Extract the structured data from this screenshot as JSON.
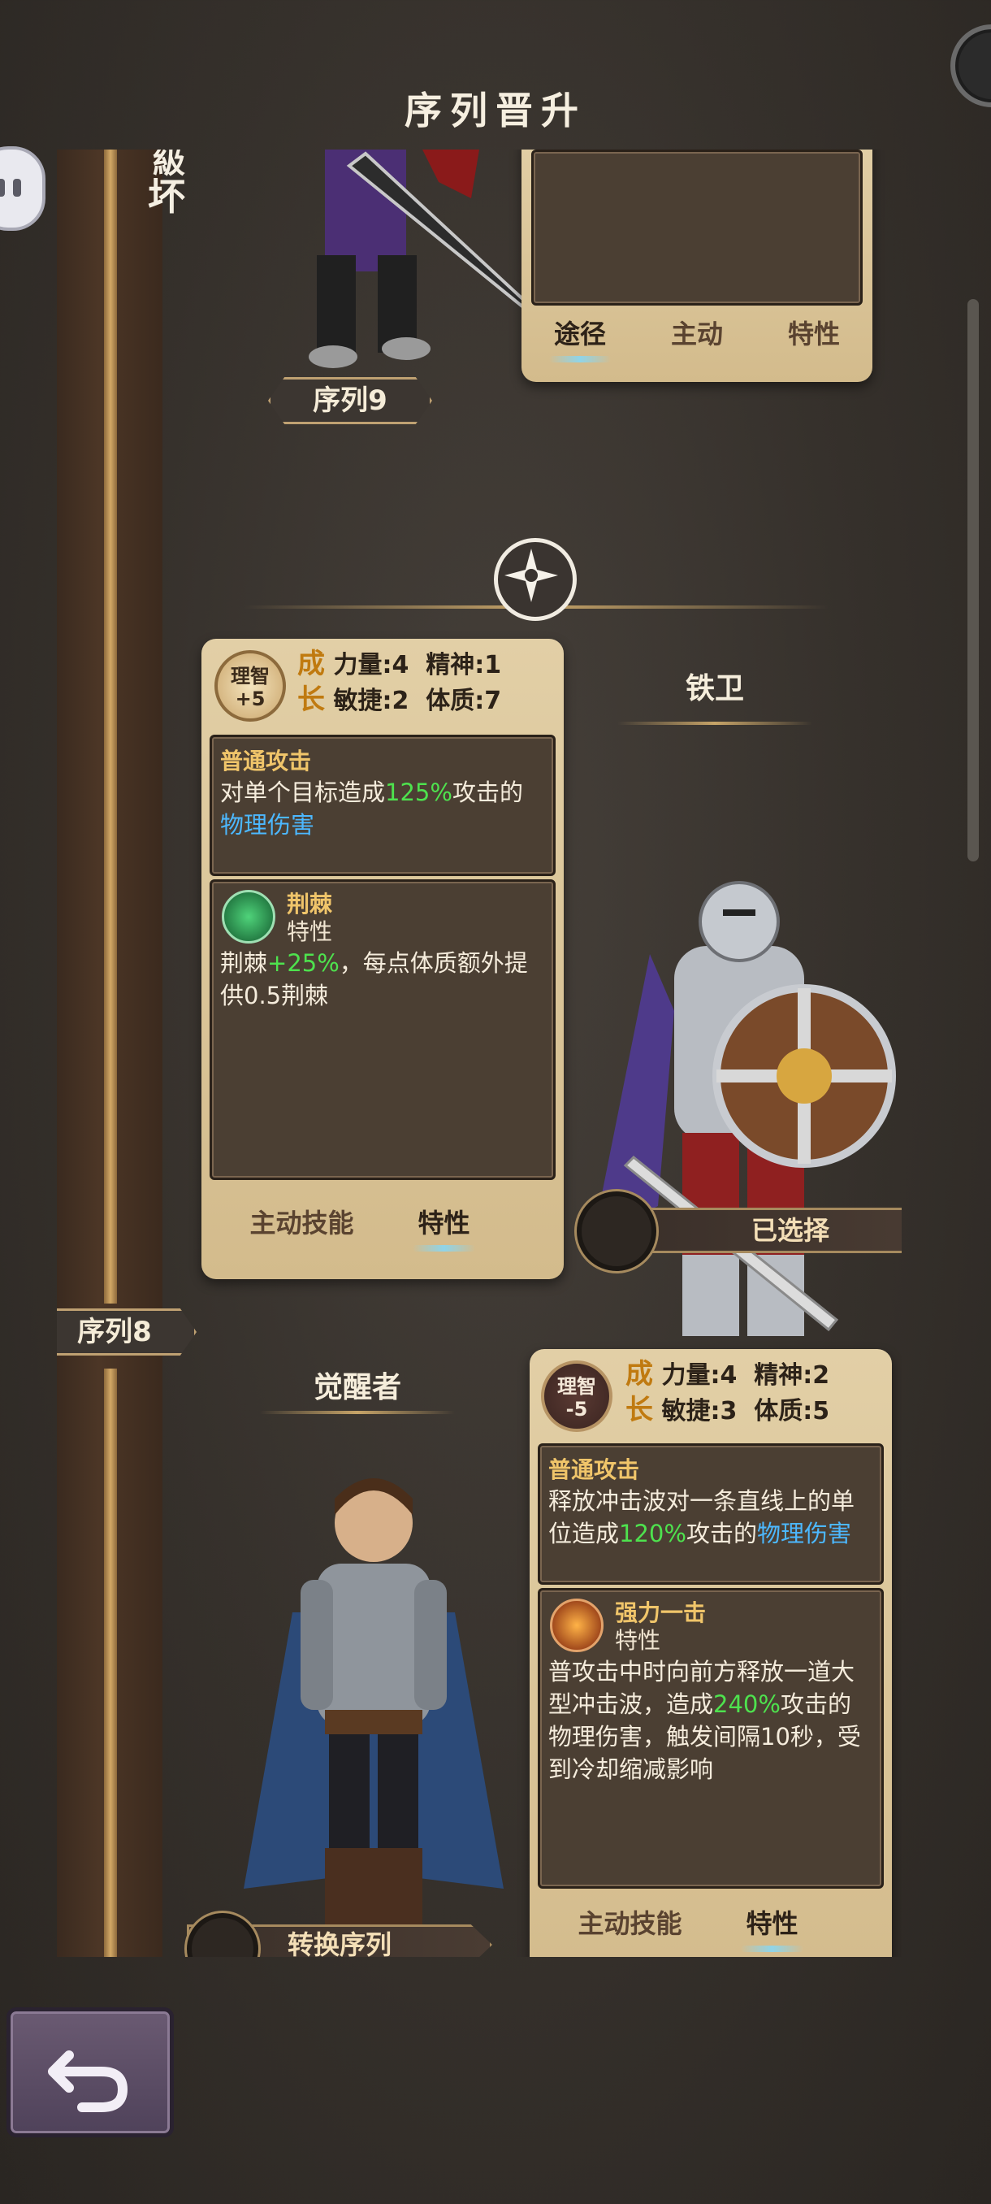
{
  "header": {
    "title": "序列晋升"
  },
  "top_fragment": {
    "side_label_top": "級",
    "side_label": "坏",
    "sequence_label": "序列9",
    "tabs": [
      "途径",
      "主动",
      "特性"
    ]
  },
  "hero1": {
    "name": "铁卫",
    "sanity": {
      "label": "理智",
      "value": "+5"
    },
    "growth_label": [
      "成",
      "长"
    ],
    "stats": {
      "strength": "力量:4",
      "spirit": "精神:1",
      "agility": "敏捷:2",
      "constitution": "体质:7"
    },
    "attack": {
      "title": "普通攻击",
      "text_pre": "对单个目标造成",
      "percent": "125%",
      "text_mid": "攻击的",
      "damage": "物理伤害"
    },
    "trait": {
      "name": "荆棘",
      "type": "特性",
      "text_pre": "荆棘",
      "percent": "+25%",
      "text_post": "，每点体质额外提供0.5荆棘"
    },
    "tabs": {
      "active_skill": "主动技能",
      "trait": "特性"
    },
    "select_label": "已选择"
  },
  "sequence8_label": "序列8",
  "hero2": {
    "name": "觉醒者",
    "sanity": {
      "label": "理智",
      "value": "-5"
    },
    "growth_label": [
      "成",
      "长"
    ],
    "stats": {
      "strength": "力量:4",
      "spirit": "精神:2",
      "agility": "敏捷:3",
      "constitution": "体质:5"
    },
    "attack": {
      "title": "普通攻击",
      "text_pre": "释放冲击波对一条直线上的单位造成",
      "percent": "120%",
      "text_mid": "攻击的",
      "damage": "物理伤害"
    },
    "trait": {
      "name": "强力一击",
      "type": "特性",
      "text_pre": "普攻击中时向前方释放一道大型冲击波，造成",
      "percent": "240%",
      "text_post": "攻击的物理伤害，触发间隔10秒，受到冷却缩减影响"
    },
    "tabs": {
      "active_skill": "主动技能",
      "trait": "特性"
    },
    "switch_label": "转换序列"
  },
  "colors": {
    "parchment": "#d9c398",
    "accent_green": "#4ee24e",
    "accent_blue": "#4cb8ff",
    "gold": "#c7a468"
  }
}
